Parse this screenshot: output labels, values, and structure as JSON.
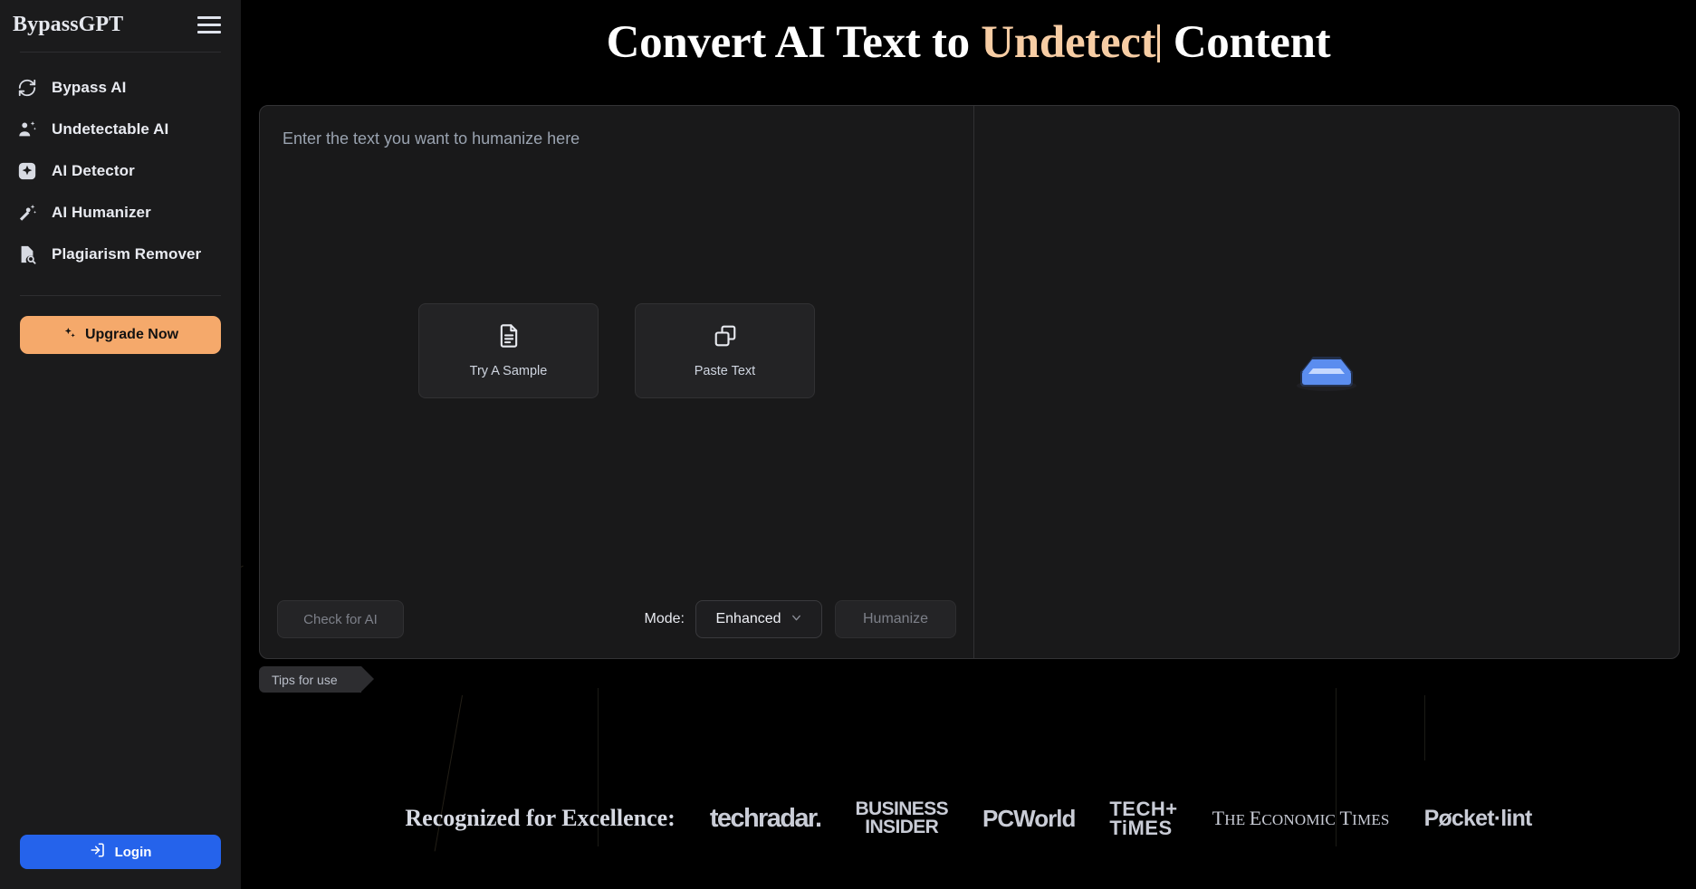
{
  "sidebar": {
    "brand": "BypassGPT",
    "menu_icon": "hamburger-icon",
    "items": [
      {
        "label": "Bypass AI",
        "icon": "refresh-circle-icon"
      },
      {
        "label": "Undetectable AI",
        "icon": "person-sparkle-icon"
      },
      {
        "label": "AI Detector",
        "icon": "sparkle-square-icon"
      },
      {
        "label": "AI Humanizer",
        "icon": "magic-wand-sparkle-icon"
      },
      {
        "label": "Plagiarism Remover",
        "icon": "document-search-icon"
      }
    ],
    "upgrade": {
      "label": "Upgrade Now",
      "icon": "sparkles-icon",
      "color": "#f5a96b"
    },
    "login": {
      "label": "Login",
      "icon": "login-arrow-icon",
      "color": "#2563eb"
    }
  },
  "header": {
    "title_before": "Convert AI Text to ",
    "title_highlight": "Undetect",
    "title_after": " Content",
    "highlight_color": "#f7cda4"
  },
  "editor": {
    "placeholder": "Enter the text you want to humanize here",
    "quick_actions": [
      {
        "label": "Try A Sample",
        "icon": "document-lines-icon"
      },
      {
        "label": "Paste Text",
        "icon": "copy-icon"
      }
    ],
    "check_button": "Check for AI",
    "mode_label": "Mode:",
    "mode_value": "Enhanced",
    "mode_caret": "chevron-down-icon",
    "humanize_button": "Humanize"
  },
  "output": {
    "empty_illustration": "inbox-envelope-icon",
    "accent_color": "#5b8def"
  },
  "tips": {
    "label": "Tips for use"
  },
  "awards": {
    "title": "Recognized for Excellence:",
    "logos": [
      {
        "name": "techradar",
        "text": "techradar."
      },
      {
        "name": "business-insider",
        "line1": "BUSINESS",
        "line2": "INSIDER"
      },
      {
        "name": "pcworld",
        "text": "PCWorld"
      },
      {
        "name": "tech-times",
        "line1": "TECH+",
        "line2": "TiMES"
      },
      {
        "name": "the-economic-times",
        "text_1": "T",
        "text_2": "HE ",
        "text_3": "E",
        "text_4": "CONOMIC ",
        "text_5": "T",
        "text_6": "IMES"
      },
      {
        "name": "pocket-lint",
        "text": "Pøcket·lint"
      }
    ]
  }
}
